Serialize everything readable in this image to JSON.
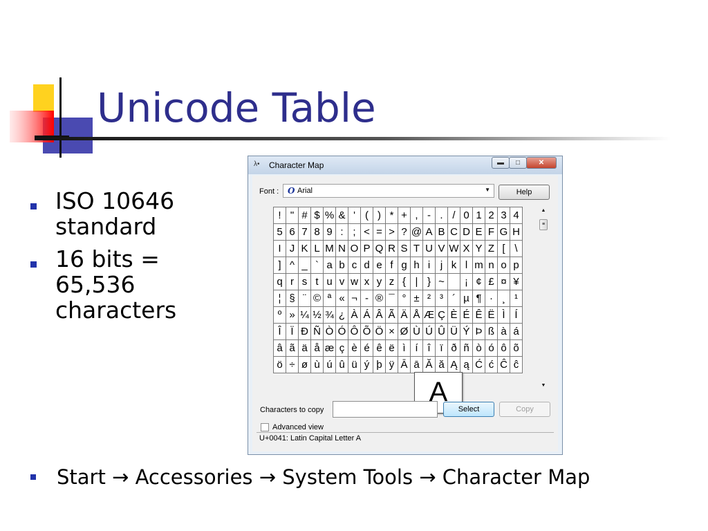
{
  "slide": {
    "title": "Unicode Table",
    "bullets": [
      "ISO 10646\nstandard",
      "16 bits =\n65,536\ncharacters"
    ],
    "bottom_text": "Start → Accessories → System Tools → Character Map"
  },
  "colors": {
    "title": "#2e2e8c",
    "bullet": "#2233aa"
  },
  "window": {
    "title": "Character Map",
    "font_label": "Font :",
    "font_value": "Arial",
    "help_label": "Help",
    "grid_rows": [
      [
        "!",
        "\"",
        "#",
        "$",
        "%",
        "&",
        "'",
        "(",
        ")",
        "*",
        "+",
        ",",
        "-",
        ".",
        "/",
        "0",
        "1",
        "2",
        "3",
        "4"
      ],
      [
        "5",
        "6",
        "7",
        "8",
        "9",
        ":",
        ";",
        "<",
        "=",
        ">",
        "?",
        "@",
        "A",
        "B",
        "C",
        "D",
        "E",
        "F",
        "G",
        "H"
      ],
      [
        "I",
        "J",
        "K",
        "L",
        "M",
        "N",
        "O",
        "P",
        "Q",
        "R",
        "S",
        "T",
        "U",
        "V",
        "W",
        "X",
        "Y",
        "Z",
        "[",
        "\\"
      ],
      [
        "]",
        "^",
        "_",
        "`",
        "a",
        "b",
        "c",
        "d",
        "e",
        "f",
        "g",
        "h",
        "i",
        "j",
        "k",
        "l",
        "m",
        "n",
        "o",
        "p"
      ],
      [
        "q",
        "r",
        "s",
        "t",
        "u",
        "v",
        "w",
        "x",
        "y",
        "z",
        "{",
        "|",
        "}",
        "~",
        "",
        "¡",
        "¢",
        "£",
        "¤",
        "¥"
      ],
      [
        "¦",
        "§",
        "¨",
        "©",
        "ª",
        "«",
        "¬",
        "-",
        "®",
        "¯",
        "°",
        "±",
        "²",
        "³",
        "´",
        "µ",
        "¶",
        "·",
        "¸",
        "¹"
      ],
      [
        "º",
        "»",
        "¼",
        "½",
        "¾",
        "¿",
        "À",
        "Á",
        "Â",
        "Ã",
        "Ä",
        "Å",
        "Æ",
        "Ç",
        "È",
        "É",
        "Ê",
        "Ë",
        "Ì",
        "Í"
      ],
      [
        "Î",
        "Ï",
        "Ð",
        "Ñ",
        "Ò",
        "Ó",
        "Ô",
        "Õ",
        "Ö",
        "×",
        "Ø",
        "Ù",
        "Ú",
        "Û",
        "Ü",
        "Ý",
        "Þ",
        "ß",
        "à",
        "á"
      ],
      [
        "â",
        "ã",
        "ä",
        "å",
        "æ",
        "ç",
        "è",
        "é",
        "ê",
        "ë",
        "ì",
        "í",
        "î",
        "ï",
        "ð",
        "ñ",
        "ò",
        "ó",
        "ô",
        "õ"
      ],
      [
        "ö",
        "÷",
        "ø",
        "ù",
        "ú",
        "û",
        "ü",
        "ý",
        "þ",
        "ÿ",
        "Ā",
        "ā",
        "Ă",
        "ă",
        "Ą",
        "ą",
        "Ć",
        "ć",
        "Ĉ",
        "ĉ"
      ]
    ],
    "enlarged_char": "A",
    "chars_to_copy_label": "Characters to copy",
    "chars_to_copy_value": "",
    "select_label": "Select",
    "copy_label": "Copy",
    "advanced_view_label": "Advanced view",
    "status_text": "U+0041: Latin Capital Letter A"
  }
}
